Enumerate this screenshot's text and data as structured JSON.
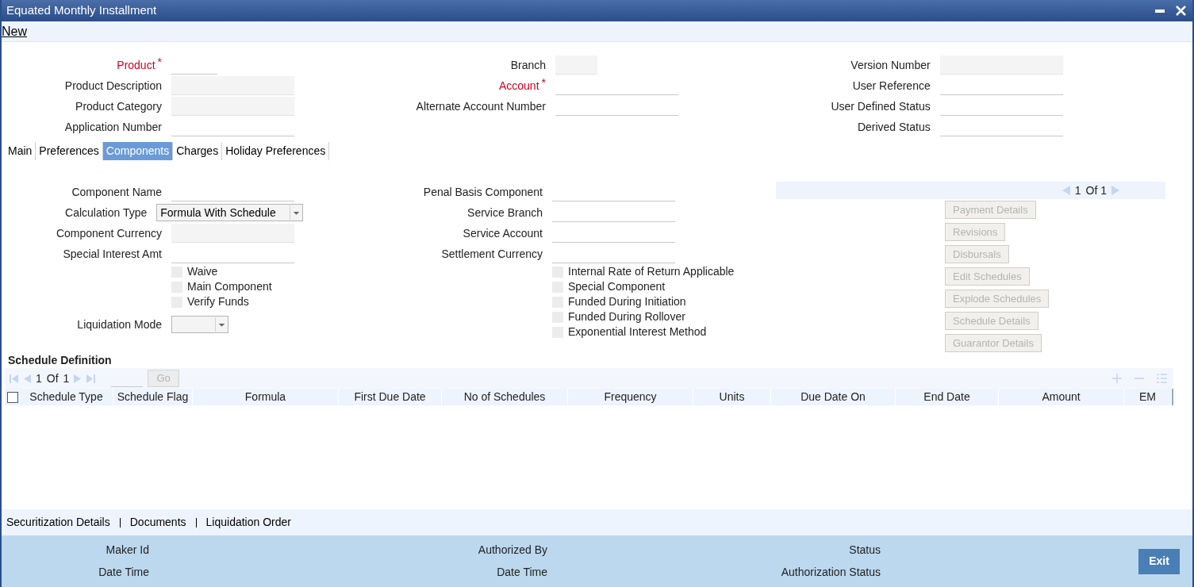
{
  "window": {
    "title": "Equated Monthly Installment"
  },
  "menu": [
    {
      "label": "New"
    }
  ],
  "header_columns": [
    [
      {
        "label": "Product",
        "required": true,
        "marker": "*",
        "kind": "text"
      },
      {
        "label": "Product Description",
        "required": false,
        "kind": "readonly"
      },
      {
        "label": "Product Category",
        "required": false,
        "kind": "readonly"
      },
      {
        "label": "Application Number",
        "required": false,
        "kind": "text"
      }
    ],
    [
      {
        "label": "Branch",
        "required": false,
        "kind": "readonly"
      },
      {
        "label": "Account",
        "required": true,
        "marker": "*",
        "kind": "text"
      },
      {
        "label": "Alternate Account Number",
        "required": false,
        "kind": "text"
      }
    ],
    [
      {
        "label": "Version Number",
        "required": false,
        "kind": "readonly"
      },
      {
        "label": "User Reference",
        "required": false,
        "kind": "text"
      },
      {
        "label": "User Defined Status",
        "required": false,
        "kind": "text"
      },
      {
        "label": "Derived Status",
        "required": false,
        "kind": "text"
      }
    ]
  ],
  "tabs": [
    {
      "label": "Main",
      "selected": false
    },
    {
      "label": "Preferences",
      "selected": false
    },
    {
      "label": "Components",
      "selected": true
    },
    {
      "label": "Charges",
      "selected": false
    },
    {
      "label": "Holiday Preferences",
      "selected": false
    }
  ],
  "component_columns": [
    [
      {
        "kind": "text",
        "label": "Component Name"
      },
      {
        "kind": "select",
        "label": "Calculation Type",
        "value": "Formula With Schedule"
      },
      {
        "kind": "readonly",
        "label": "Component Currency"
      },
      {
        "kind": "text",
        "label": "Special Interest Amt"
      },
      {
        "kind": "checkbox",
        "label": "Waive",
        "checked": false
      },
      {
        "kind": "checkbox",
        "label": "Main Component",
        "checked": false
      },
      {
        "kind": "checkbox",
        "label": "Verify Funds",
        "checked": false
      },
      {
        "kind": "select",
        "label": "Liquidation Mode"
      }
    ],
    [
      {
        "kind": "text",
        "label": "Penal Basis Component"
      },
      {
        "kind": "text",
        "label": "Service Branch"
      },
      {
        "kind": "text",
        "label": "Service Account"
      },
      {
        "kind": "text",
        "label": "Settlement Currency"
      },
      {
        "kind": "checkbox",
        "label": "Internal Rate of Return Applicable",
        "checked": false
      },
      {
        "kind": "checkbox",
        "label": "Special Component",
        "checked": false
      },
      {
        "kind": "checkbox",
        "label": "Funded During Initiation",
        "checked": false
      },
      {
        "kind": "checkbox",
        "label": "Funded During Rollover",
        "checked": false
      },
      {
        "kind": "checkbox",
        "label": "Exponential Interest Method",
        "checked": false
      }
    ]
  ],
  "component_pager": {
    "page": "1",
    "of": "Of 1"
  },
  "component_buttons": [
    {
      "label": "Payment Details",
      "disabled": true
    },
    {
      "label": "Revisions",
      "disabled": true
    },
    {
      "label": "Disbursals",
      "disabled": true
    },
    {
      "label": "Edit Schedules",
      "disabled": true
    },
    {
      "label": "Explode Schedules",
      "disabled": true
    },
    {
      "label": "Schedule Details",
      "disabled": true
    },
    {
      "label": "Guarantor Details",
      "disabled": true
    }
  ],
  "schedule_definition": {
    "title": "Schedule Definition",
    "pager": {
      "page": "1",
      "of": "Of",
      "total": "1"
    },
    "go_button": "Go",
    "select_all_checked": false,
    "columns": [
      "Schedule Type",
      "Schedule Flag",
      "Formula",
      "First Due Date",
      "No of Schedules",
      "Frequency",
      "Units",
      "Due Date On",
      "End Date",
      "Amount",
      "EM"
    ]
  },
  "bottom_links": [
    "Securitization Details",
    "Documents",
    "Liquidation Order"
  ],
  "footer": {
    "columns": [
      [
        "Maker Id",
        "Date Time"
      ],
      [
        "Authorized By",
        "Date Time"
      ],
      [
        "Status",
        "Authorization Status"
      ]
    ],
    "exit_button": "Exit"
  }
}
